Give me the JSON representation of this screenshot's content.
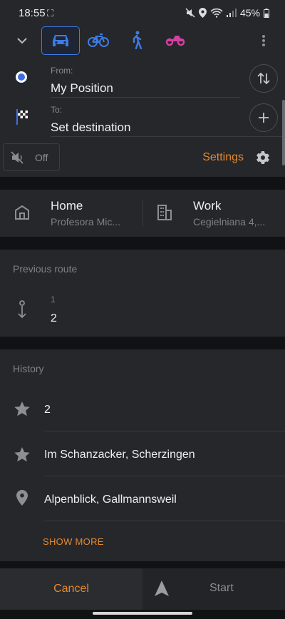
{
  "status_bar": {
    "time": "18:55",
    "battery": "45%"
  },
  "route": {
    "from_label": "From:",
    "from_value": "My Position",
    "to_label": "To:",
    "to_value": "Set destination"
  },
  "sound": {
    "label": "Off"
  },
  "settings": {
    "label": "Settings"
  },
  "places": {
    "home": {
      "title": "Home",
      "subtitle": "Profesora Mic..."
    },
    "work": {
      "title": "Work",
      "subtitle": "Cegielniana 4,..."
    }
  },
  "previous_route": {
    "title": "Previous route",
    "start": "1",
    "end": "2"
  },
  "history": {
    "title": "History",
    "items": [
      {
        "icon": "star-icon",
        "label": "2"
      },
      {
        "icon": "star-icon",
        "label": "Im Schanzacker, Scherzingen"
      },
      {
        "icon": "location-pin-icon",
        "label": "Alpenblick, Gallmannsweil"
      }
    ],
    "show_more": "SHOW MORE"
  },
  "bottom": {
    "cancel": "Cancel",
    "start": "Start"
  },
  "colors": {
    "accent_orange": "#e3892f",
    "accent_blue": "#3d7ce6",
    "moto_pink": "#d63fa0",
    "panel": "#26272b",
    "background": "#111214"
  }
}
